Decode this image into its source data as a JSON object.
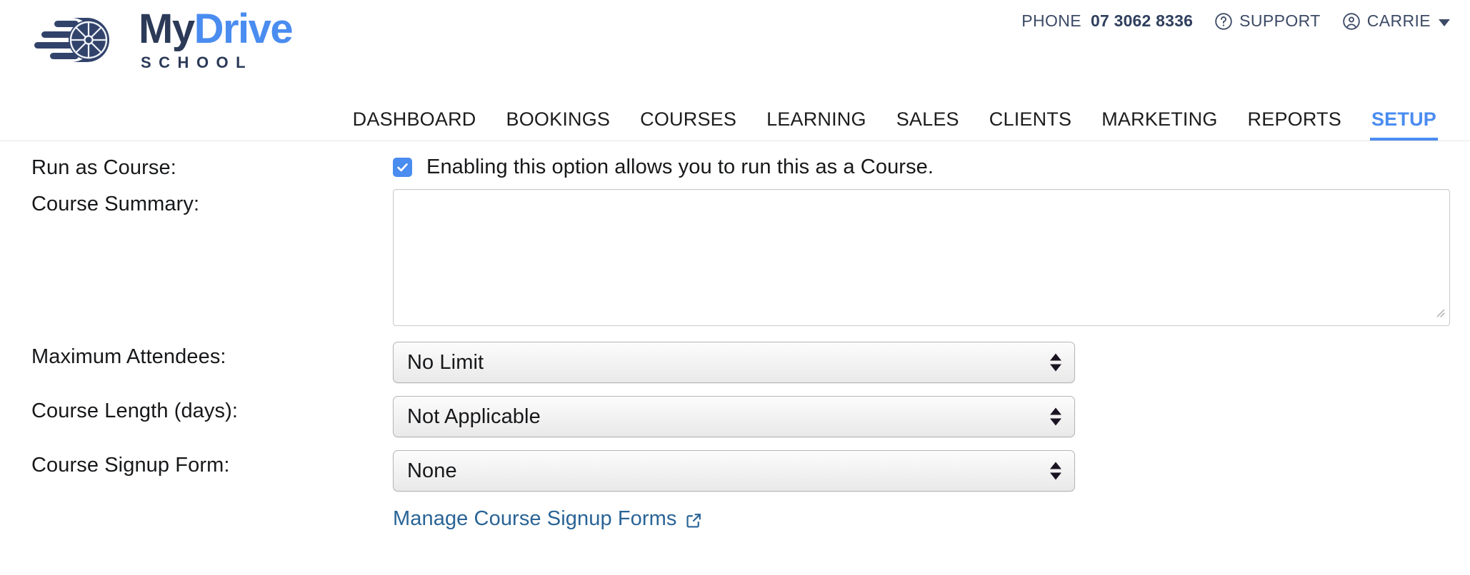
{
  "header": {
    "utility": {
      "phone_label": "PHONE",
      "phone_number": "07 3062 8336",
      "support_label": "SUPPORT",
      "account_label": "CARRIE"
    },
    "logo": {
      "title_part1": "My",
      "title_part2": "Drive",
      "subtitle": "SCHOOL",
      "brand_dark": "#2c3a58",
      "brand_blue": "#4a8cf0"
    },
    "nav": [
      {
        "label": "DASHBOARD",
        "active": false
      },
      {
        "label": "BOOKINGS",
        "active": false
      },
      {
        "label": "COURSES",
        "active": false
      },
      {
        "label": "LEARNING",
        "active": false
      },
      {
        "label": "SALES",
        "active": false
      },
      {
        "label": "CLIENTS",
        "active": false
      },
      {
        "label": "MARKETING",
        "active": false
      },
      {
        "label": "REPORTS",
        "active": false
      },
      {
        "label": "SETUP",
        "active": true
      }
    ]
  },
  "form": {
    "run_as_course": {
      "label": "Run as Course:",
      "checked": true,
      "description": "Enabling this option allows you to run this as a Course."
    },
    "course_summary": {
      "label": "Course Summary:",
      "value": "",
      "placeholder": ""
    },
    "maximum_attendees": {
      "label": "Maximum Attendees:",
      "selected": "No Limit"
    },
    "course_length": {
      "label": "Course Length (days):",
      "selected": "Not Applicable"
    },
    "course_signup_form": {
      "label": "Course Signup Form:",
      "selected": "None",
      "manage_link": "Manage Course Signup Forms"
    }
  },
  "colors": {
    "accent_blue": "#4a8cf0",
    "header_text": "#3c4a66",
    "link_blue": "#2a6496",
    "body_text": "#17181a"
  },
  "icons": {
    "support": "question-circle-icon",
    "account": "user-circle-icon",
    "account_caret": "chevron-down-icon",
    "external": "external-link-icon",
    "checkbox_check": "check-icon",
    "select_arrows": "sort-arrows-icon",
    "textarea_grip": "resize-grip-icon"
  }
}
